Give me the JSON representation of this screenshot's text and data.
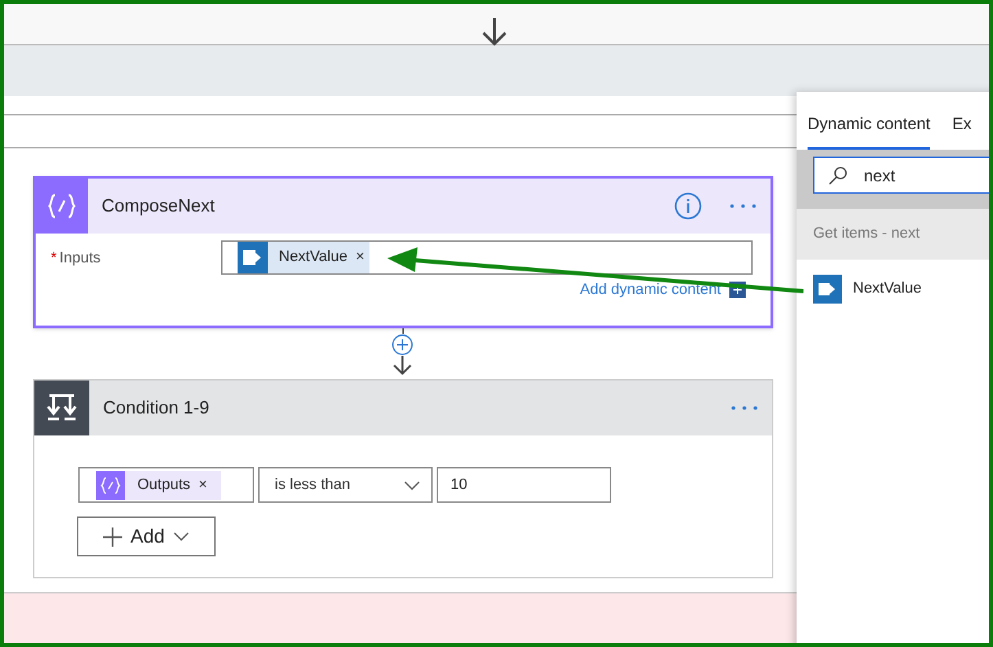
{
  "compose": {
    "title": "ComposeNext",
    "required_mark": "*",
    "inputs_label": "Inputs",
    "token": {
      "label": "NextValue",
      "remove": "×"
    },
    "add_dynamic_content": "Add dynamic content"
  },
  "condition": {
    "title": "Condition 1-9",
    "operand": {
      "label": "Outputs",
      "remove": "×"
    },
    "operator": "is less than",
    "value": "10",
    "add_button": "Add"
  },
  "panel": {
    "tabs": [
      {
        "label": "Dynamic content",
        "selected": true
      },
      {
        "label": "Ex",
        "selected": false
      }
    ],
    "search": {
      "value": "next"
    },
    "group": "Get items - next",
    "items": [
      {
        "label": "NextValue"
      }
    ]
  }
}
